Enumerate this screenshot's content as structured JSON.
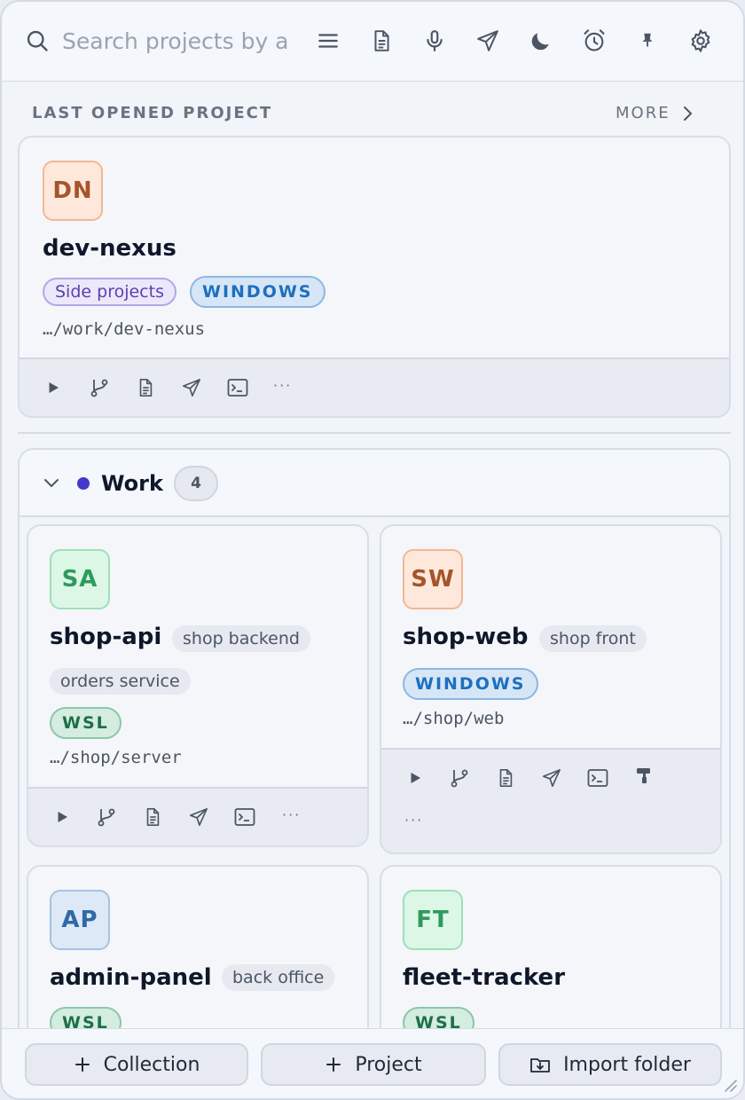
{
  "search": {
    "placeholder": "Search projects by a"
  },
  "toolbar": {
    "icons": [
      "menu-icon",
      "document-icon",
      "microphone-icon",
      "send-icon",
      "moon-icon",
      "alarm-icon",
      "pin-icon",
      "gear-icon"
    ]
  },
  "last_opened": {
    "heading": "LAST OPENED PROJECT",
    "more_label": "MORE",
    "project": {
      "initials": "DN",
      "name": "dev-nexus",
      "tags": [
        "Side projects"
      ],
      "platform": "WINDOWS",
      "path": "…/work/dev-nexus",
      "actions": [
        "play-icon",
        "git-branch-icon",
        "document-icon",
        "send-icon",
        "terminal-icon",
        "more-icon"
      ],
      "more_dots": "···"
    }
  },
  "group": {
    "name": "Work",
    "count": "4",
    "color": "#4338ca",
    "projects": [
      {
        "initials": "SA",
        "name": "shop-api",
        "tags": [
          "shop backend",
          "orders service"
        ],
        "platform": "WSL",
        "path": "…/shop/server",
        "more_dots": "···"
      },
      {
        "initials": "SW",
        "name": "shop-web",
        "tags": [
          "shop front"
        ],
        "platform": "WINDOWS",
        "path": "…/shop/web",
        "more_dots": "···"
      },
      {
        "initials": "AP",
        "name": "admin-panel",
        "tags": [
          "back office"
        ],
        "platform": "WSL"
      },
      {
        "initials": "FT",
        "name": "fleet-tracker",
        "tags": [],
        "platform": "WSL"
      }
    ]
  },
  "footer": {
    "collection_label": "Collection",
    "project_label": "Project",
    "import_label": "Import folder"
  }
}
